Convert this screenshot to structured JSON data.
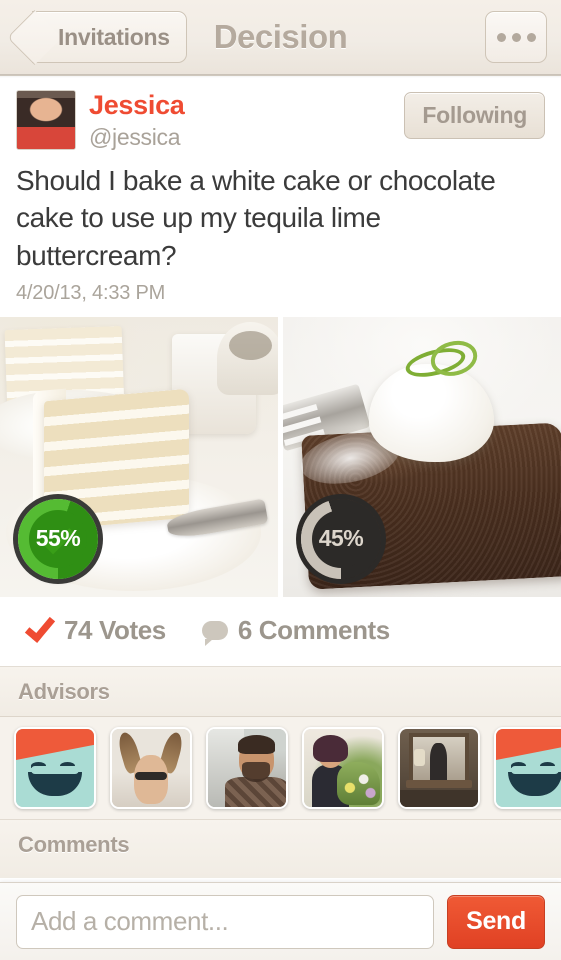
{
  "navbar": {
    "back_label": "Invitations",
    "title": "Decision",
    "more_icon": "ellipsis-icon"
  },
  "post": {
    "author_name": "Jessica",
    "author_handle": "@jessica",
    "follow_label": "Following",
    "question": "Should I bake a white cake or chocolate cake to use up my tequila lime buttercream?",
    "timestamp": "4/20/13, 4:33 PM",
    "avatar_alt": "jessica-avatar"
  },
  "choices": [
    {
      "id": "white-cake",
      "percent_label": "55%",
      "percent": 55,
      "winner": true,
      "color": "#2f8f14",
      "image_alt": "white-layer-cake-slice"
    },
    {
      "id": "chocolate-cake",
      "percent_label": "45%",
      "percent": 45,
      "winner": false,
      "color": "#2c2a28",
      "image_alt": "chocolate-cake-slice-with-cream"
    }
  ],
  "stats": {
    "votes_label": "74 Votes",
    "votes_count": 74,
    "comments_label": "6 Comments",
    "comments_count": 6,
    "votes_icon": "check-icon",
    "comments_icon": "speech-bubble-icon"
  },
  "advisors": {
    "title": "Advisors",
    "items": [
      {
        "id": "advisor-1",
        "type": "placeholder-smiley"
      },
      {
        "id": "advisor-2",
        "type": "photo-antlers"
      },
      {
        "id": "advisor-3",
        "type": "photo-man"
      },
      {
        "id": "advisor-4",
        "type": "photo-woman-flowers"
      },
      {
        "id": "advisor-5",
        "type": "photo-mirror"
      },
      {
        "id": "advisor-6",
        "type": "placeholder-smiley"
      }
    ]
  },
  "comments": {
    "title": "Comments"
  },
  "composer": {
    "placeholder": "Add a comment...",
    "value": "",
    "send_label": "Send"
  },
  "colors": {
    "accent": "#ef4b32",
    "winner_green": "#2f8f14",
    "chrome": "#f1ece5",
    "muted_text": "#a9a299"
  }
}
